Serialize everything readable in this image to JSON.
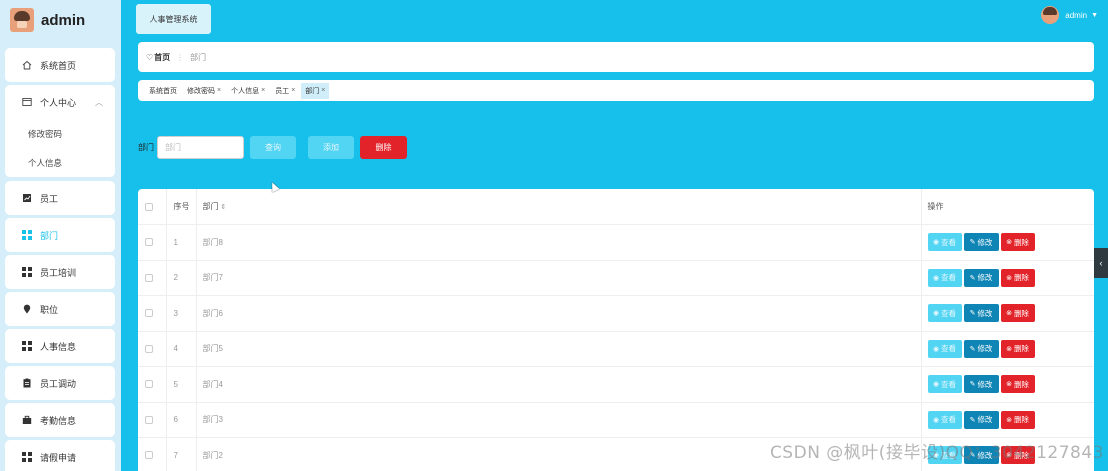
{
  "sidebar": {
    "brand_title": "admin",
    "items": [
      {
        "label": "系统首页",
        "icon": "home-icon"
      },
      {
        "label": "个人中心",
        "icon": "window-icon",
        "expanded": true,
        "children": [
          {
            "label": "修改密码"
          },
          {
            "label": "个人信息"
          }
        ]
      },
      {
        "label": "员工",
        "icon": "chart-icon"
      },
      {
        "label": "部门",
        "icon": "grid-icon",
        "active": true
      },
      {
        "label": "员工培训",
        "icon": "grid-icon"
      },
      {
        "label": "职位",
        "icon": "pin-icon"
      },
      {
        "label": "人事信息",
        "icon": "grid-icon"
      },
      {
        "label": "员工调动",
        "icon": "clipboard-icon"
      },
      {
        "label": "考勤信息",
        "icon": "briefcase-icon"
      },
      {
        "label": "请假申请",
        "icon": "grid-icon"
      }
    ]
  },
  "header": {
    "system_title": "人事管理系统",
    "user_name": "admin"
  },
  "breadcrumb": {
    "home": "首页",
    "current": "部门"
  },
  "tags": [
    {
      "label": "系统首页",
      "closable": false
    },
    {
      "label": "修改密码",
      "closable": true
    },
    {
      "label": "个人信息",
      "closable": true
    },
    {
      "label": "员工",
      "closable": true
    },
    {
      "label": "部门",
      "closable": true,
      "active": true
    }
  ],
  "search": {
    "label": "部门",
    "placeholder": "部门",
    "search_button": "查询",
    "add_button": "添加",
    "delete_button": "删除"
  },
  "table": {
    "headers": {
      "index": "序号",
      "name": "部门",
      "sort_icon": "sort-icon",
      "operation": "操作"
    },
    "rows": [
      {
        "index": "1",
        "name": "部门8"
      },
      {
        "index": "2",
        "name": "部门7"
      },
      {
        "index": "3",
        "name": "部门6"
      },
      {
        "index": "4",
        "name": "部门5"
      },
      {
        "index": "5",
        "name": "部门4"
      },
      {
        "index": "6",
        "name": "部门3"
      },
      {
        "index": "7",
        "name": "部门2"
      }
    ],
    "row_actions": {
      "view": "查看",
      "edit": "修改",
      "delete": "删除"
    }
  },
  "watermark": "CSDN @枫叶(接毕设)QQ：3042127843",
  "colors": {
    "main_bg": "#16c0ea",
    "sidebar_bg": "#d6eef9",
    "accent_light": "#52d4f3",
    "edit": "#0f85b5",
    "danger": "#e2232a"
  }
}
